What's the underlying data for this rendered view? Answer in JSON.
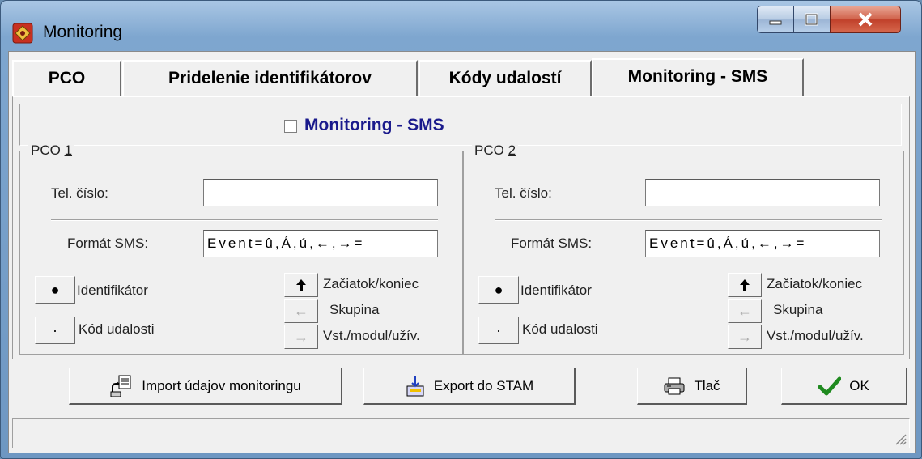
{
  "window": {
    "title": "Monitoring"
  },
  "tabs": [
    {
      "label": "PCO"
    },
    {
      "label": "Pridelenie identifikátorov"
    },
    {
      "label": "Kódy udalostí"
    },
    {
      "label": "Monitoring - SMS"
    }
  ],
  "active_tab": "Monitoring - SMS",
  "header": {
    "checkbox_label": "Monitoring - SMS",
    "checked": false
  },
  "groups": [
    {
      "title_prefix": "PCO ",
      "title_underlined": "1",
      "tel_label": "Tel. číslo:",
      "tel_value": "",
      "format_label": "Formát SMS:",
      "format_value": "Event=û,Á,ú,←,→=",
      "identifier_button": "●",
      "identifier_label": "Identifikátor",
      "event_code_button": "·",
      "event_code_label": "Kód udalosti",
      "start_end_label": "Začiatok/koniec",
      "group_label": "Skupina",
      "input_label": "Vst./modul/užív."
    },
    {
      "title_prefix": "PCO ",
      "title_underlined": "2",
      "tel_label": "Tel. číslo:",
      "tel_value": "",
      "format_label": "Formát SMS:",
      "format_value": "Event=û,Á,ú,←,→=",
      "identifier_button": "●",
      "identifier_label": "Identifikátor",
      "event_code_button": "·",
      "event_code_label": "Kód udalosti",
      "start_end_label": "Začiatok/koniec",
      "group_label": "Skupina",
      "input_label": "Vst./modul/užív."
    }
  ],
  "buttons": {
    "import": "Import údajov monitoringu",
    "export": "Export do STAM",
    "print": "Tlač",
    "ok": "OK"
  },
  "arrows": {
    "up": "🡡",
    "left": "←",
    "right": "→"
  },
  "colors": {
    "checkbox_label": "#1a1a8c",
    "ok_check": "#1f8a1f"
  }
}
